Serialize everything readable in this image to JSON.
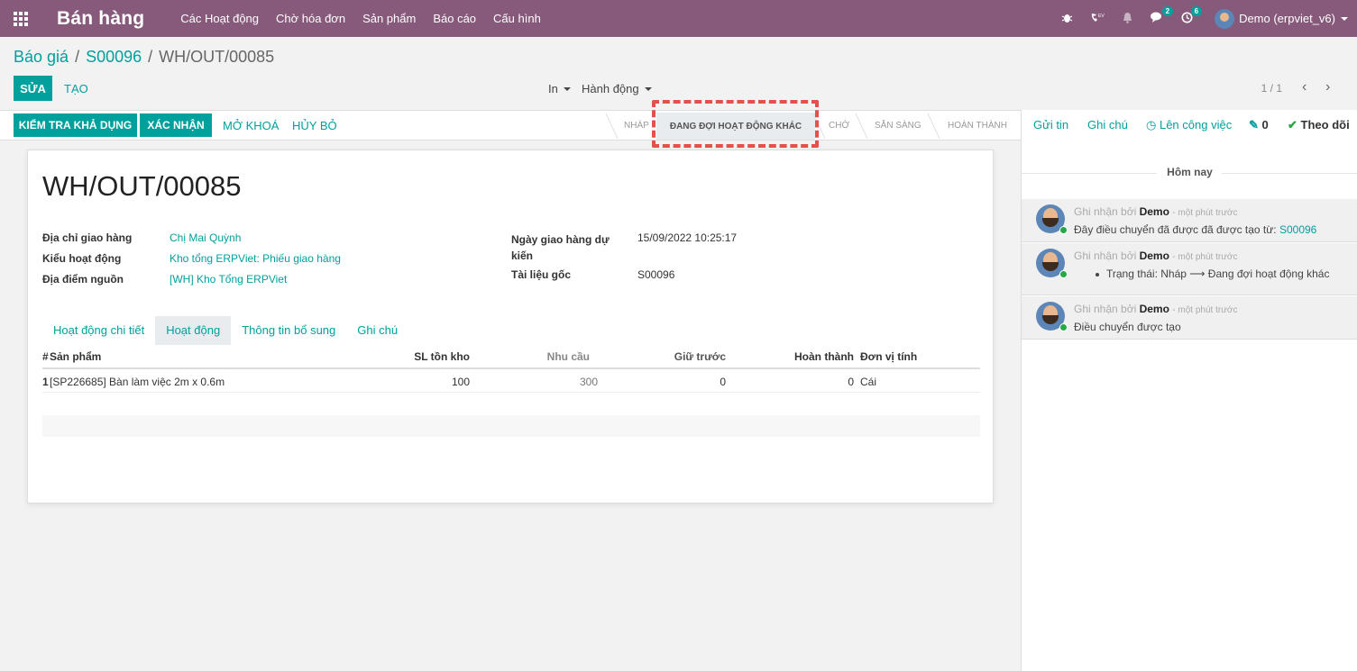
{
  "navbar": {
    "app_name": "Bán hàng",
    "menu": [
      "Các Hoạt động",
      "Chờ hóa đơn",
      "Sản phẩm",
      "Báo cáo",
      "Cấu hình"
    ],
    "messages_count": "2",
    "activities_count": "6",
    "user": "Demo (erpviet_v6)"
  },
  "breadcrumb": {
    "root": "Báo giá",
    "parent": "S00096",
    "current": "WH/OUT/00085"
  },
  "controls": {
    "edit": "SỬA",
    "create": "TẠO",
    "print": "In",
    "action": "Hành động",
    "pager": "1 / 1"
  },
  "actions": {
    "check_availability": "KIỂM TRA KHẢ DỤNG",
    "confirm": "XÁC NHẬN",
    "unlock": "MỞ KHOÁ",
    "cancel": "HỦY BỎ"
  },
  "statusbar": {
    "draft": "NHÁP",
    "waiting_other": "ĐANG ĐỢI HOẠT ĐỘNG KHÁC",
    "waiting": "CHỜ",
    "ready": "SẴN SÀNG",
    "done": "HOÀN THÀNH"
  },
  "record": {
    "title": "WH/OUT/00085",
    "delivery_address_label": "Địa chỉ giao hàng",
    "delivery_address": "Chị Mai Quỳnh",
    "operation_type_label": "Kiểu hoạt động",
    "operation_type": "Kho tổng ERPViet: Phiếu giao hàng",
    "source_location_label": "Địa điểm nguồn",
    "source_location": "[WH] Kho Tổng ERPViet",
    "scheduled_date_label": "Ngày giao hàng dự kiến",
    "scheduled_date": "15/09/2022 10:25:17",
    "source_document_label": "Tài liệu gốc",
    "source_document": "S00096"
  },
  "tabs": [
    "Hoạt động chi tiết",
    "Hoạt động",
    "Thông tin bổ sung",
    "Ghi chú"
  ],
  "table": {
    "columns": [
      "#",
      "Sản phẩm",
      "SL tồn kho",
      "Nhu cầu",
      "Giữ trước",
      "Hoàn thành",
      "Đơn vị tính"
    ],
    "rows": [
      {
        "index": "1",
        "product": "[SP226685] Bàn làm việc 2m x 0.6m",
        "on_hand": "100",
        "demand": "300",
        "reserved": "0",
        "done": "0",
        "uom": "Cái"
      }
    ]
  },
  "chatter": {
    "send_message": "Gửi tin",
    "log_note": "Ghi chú",
    "schedule_activity": "Lên công việc",
    "attachments": "0",
    "follow": "Theo dõi",
    "date_separator": "Hôm nay",
    "messages": [
      {
        "prefix": "Ghi nhận bởi",
        "author": "Demo",
        "time": "- một phút trước",
        "body": "Đây điều chuyển đã được đã được tạo từ:",
        "link": "S00096"
      },
      {
        "prefix": "Ghi nhận bởi",
        "author": "Demo",
        "time": "- một phút trước",
        "body": "Trạng thái: Nháp ⟶ Đang đợi hoạt động khác"
      },
      {
        "prefix": "Ghi nhận bởi",
        "author": "Demo",
        "time": "- một phút trước",
        "body": "Điều chuyển được tạo"
      }
    ]
  },
  "colors": {
    "navbar": "#875a7b",
    "primary": "#00a09d",
    "highlight": "#e5504b"
  }
}
